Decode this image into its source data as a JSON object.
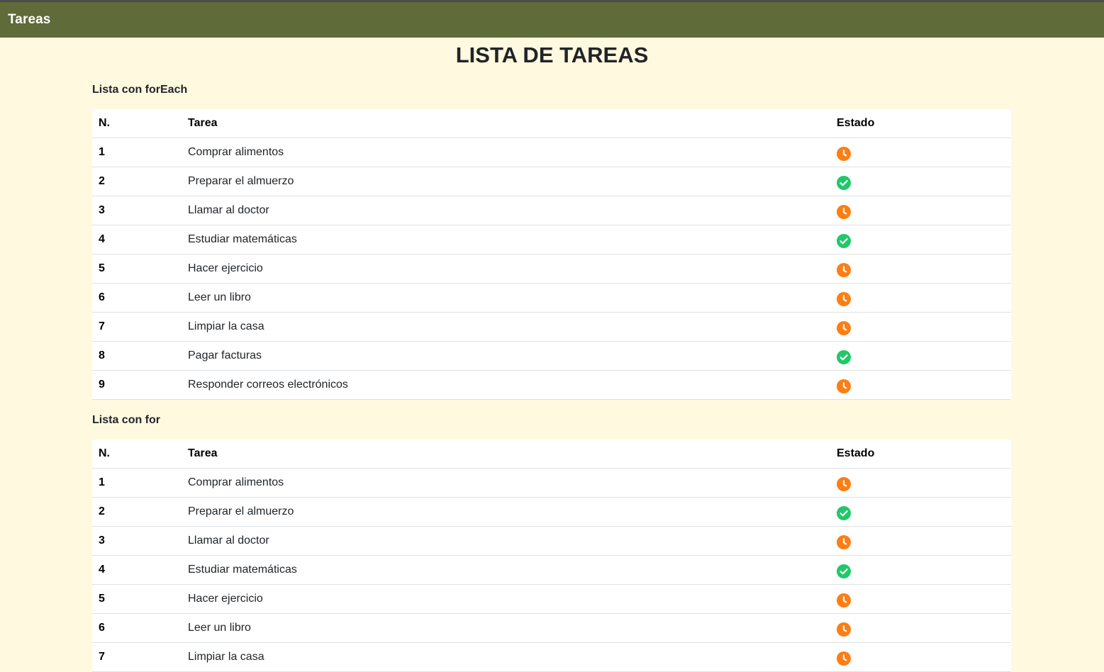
{
  "app": {
    "brand": "Tareas"
  },
  "page": {
    "title": "LISTA DE TAREAS"
  },
  "colors": {
    "navbar": "#5f6b38",
    "background": "#fff9df",
    "pending": "#fd7e14",
    "done": "#20c86a"
  },
  "sections": [
    {
      "title": "Lista con forEach",
      "headers": {
        "num": "N.",
        "task": "Tarea",
        "state": "Estado"
      },
      "rows": [
        {
          "num": "1",
          "task": "Comprar alimentos",
          "state": "pending",
          "icon": "clock-icon"
        },
        {
          "num": "2",
          "task": "Preparar el almuerzo",
          "state": "done",
          "icon": "check-circle-icon"
        },
        {
          "num": "3",
          "task": "Llamar al doctor",
          "state": "pending",
          "icon": "clock-icon"
        },
        {
          "num": "4",
          "task": "Estudiar matemáticas",
          "state": "done",
          "icon": "check-circle-icon"
        },
        {
          "num": "5",
          "task": "Hacer ejercicio",
          "state": "pending",
          "icon": "clock-icon"
        },
        {
          "num": "6",
          "task": "Leer un libro",
          "state": "pending",
          "icon": "clock-icon"
        },
        {
          "num": "7",
          "task": "Limpiar la casa",
          "state": "pending",
          "icon": "clock-icon"
        },
        {
          "num": "8",
          "task": "Pagar facturas",
          "state": "done",
          "icon": "check-circle-icon"
        },
        {
          "num": "9",
          "task": "Responder correos electrónicos",
          "state": "pending",
          "icon": "clock-icon"
        }
      ]
    },
    {
      "title": "Lista con for",
      "headers": {
        "num": "N.",
        "task": "Tarea",
        "state": "Estado"
      },
      "rows": [
        {
          "num": "1",
          "task": "Comprar alimentos",
          "state": "pending",
          "icon": "clock-icon"
        },
        {
          "num": "2",
          "task": "Preparar el almuerzo",
          "state": "done",
          "icon": "check-circle-icon"
        },
        {
          "num": "3",
          "task": "Llamar al doctor",
          "state": "pending",
          "icon": "clock-icon"
        },
        {
          "num": "4",
          "task": "Estudiar matemáticas",
          "state": "done",
          "icon": "check-circle-icon"
        },
        {
          "num": "5",
          "task": "Hacer ejercicio",
          "state": "pending",
          "icon": "clock-icon"
        },
        {
          "num": "6",
          "task": "Leer un libro",
          "state": "pending",
          "icon": "clock-icon"
        },
        {
          "num": "7",
          "task": "Limpiar la casa",
          "state": "pending",
          "icon": "clock-icon"
        }
      ]
    }
  ]
}
